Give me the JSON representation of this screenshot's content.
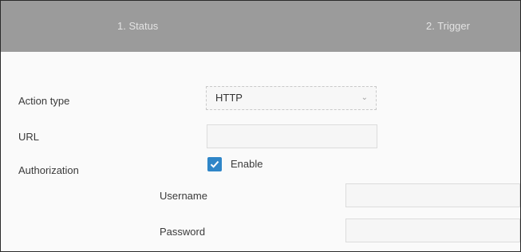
{
  "tabs": [
    {
      "label": "1. Status"
    },
    {
      "label": "2. Trigger"
    }
  ],
  "form": {
    "action_type": {
      "label": "Action type",
      "selected": "HTTP"
    },
    "url": {
      "label": "URL",
      "value": ""
    },
    "authorization": {
      "label": "Authorization",
      "enable_label": "Enable",
      "enabled": true
    },
    "username": {
      "label": "Username",
      "value": ""
    },
    "password": {
      "label": "Password",
      "value": ""
    }
  },
  "colors": {
    "tabbar": "#9b9b9b",
    "checkbox": "#2f86c8"
  }
}
